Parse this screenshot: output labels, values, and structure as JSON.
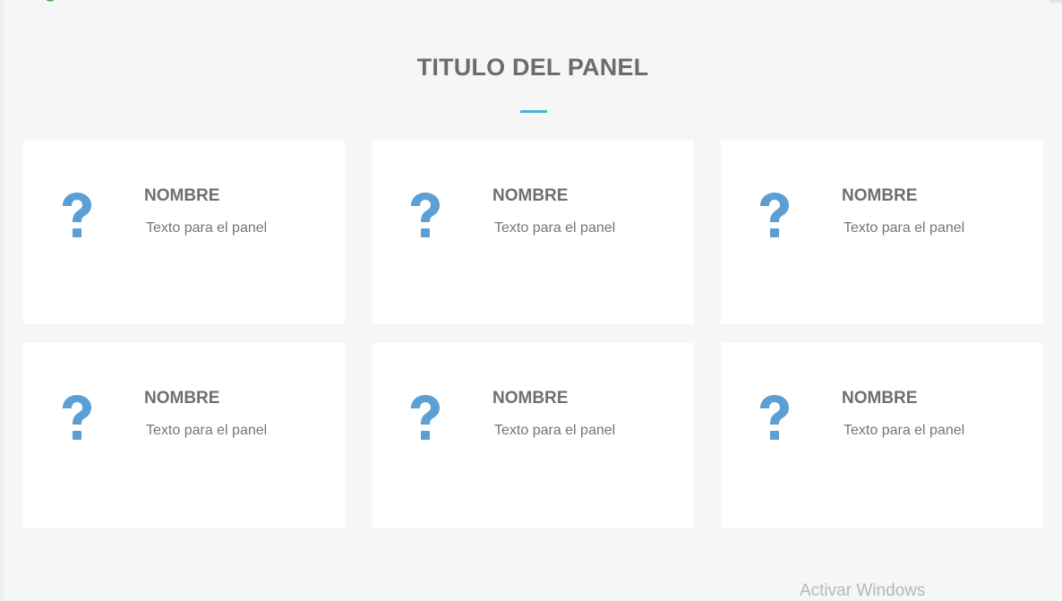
{
  "panel": {
    "title": "TITULO DEL PANEL",
    "accent_color": "#3fb7cf",
    "icon_color": "#5b9fd4",
    "cards": [
      {
        "icon": "question-mark-icon",
        "name": "NOMBRE",
        "text": "Texto para el panel"
      },
      {
        "icon": "question-mark-icon",
        "name": "NOMBRE",
        "text": "Texto para el panel"
      },
      {
        "icon": "question-mark-icon",
        "name": "NOMBRE",
        "text": "Texto para el panel"
      },
      {
        "icon": "question-mark-icon",
        "name": "NOMBRE",
        "text": "Texto para el panel"
      },
      {
        "icon": "question-mark-icon",
        "name": "NOMBRE",
        "text": "Texto para el panel"
      },
      {
        "icon": "question-mark-icon",
        "name": "NOMBRE",
        "text": "Texto para el panel"
      }
    ]
  },
  "overlay": {
    "watermark": "Activar Windows"
  }
}
